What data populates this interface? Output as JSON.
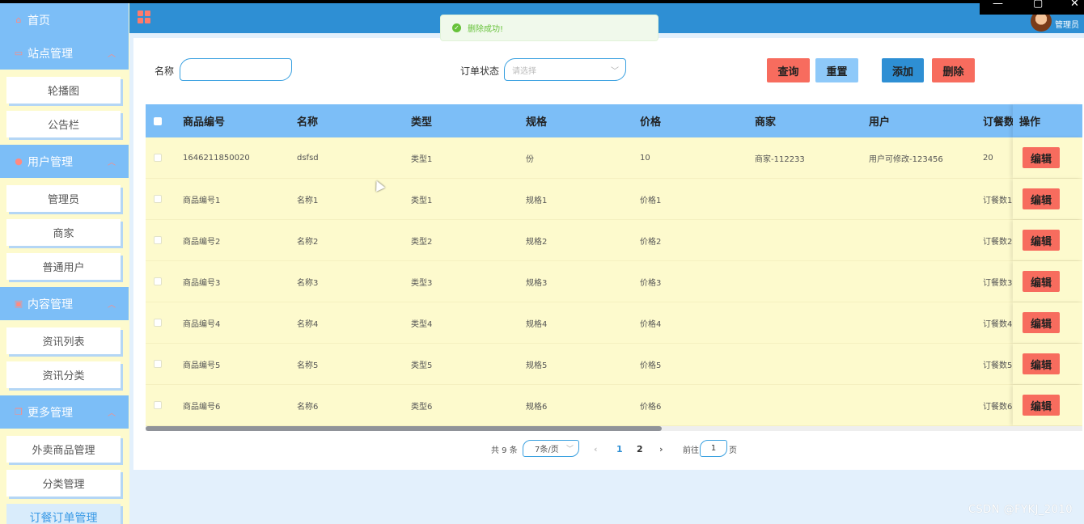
{
  "header": {
    "admin_name": "管理员",
    "window_controls": [
      "—",
      "▢",
      "✕"
    ]
  },
  "toast": {
    "message": "删除成功!"
  },
  "sidebar": {
    "home": "首页",
    "groups": [
      {
        "label": "站点管理",
        "icon": "monitor-icon",
        "items": [
          "轮播图",
          "公告栏"
        ]
      },
      {
        "label": "用户管理",
        "icon": "user-icon",
        "items": [
          "管理员",
          "商家",
          "普通用户"
        ]
      },
      {
        "label": "内容管理",
        "icon": "content-icon",
        "items": [
          "资讯列表",
          "资讯分类"
        ]
      },
      {
        "label": "更多管理",
        "icon": "copy-icon",
        "items": [
          "外卖商品管理",
          "分类管理",
          "订餐订单管理"
        ]
      }
    ],
    "active_item": "订餐订单管理"
  },
  "search": {
    "name_label": "名称",
    "name_value": "",
    "status_label": "订单状态",
    "status_placeholder": "请选择"
  },
  "buttons": {
    "query": "查询",
    "reset": "重置",
    "add": "添加",
    "delete": "删除",
    "edit": "编辑"
  },
  "colors": {
    "query": "#f76c5e",
    "reset": "#8ec9f9",
    "add": "#2e8fd4",
    "delete": "#f76c5e"
  },
  "table": {
    "columns": [
      "商品编号",
      "名称",
      "类型",
      "规格",
      "价格",
      "商家",
      "用户",
      "订餐数",
      "操作"
    ],
    "rows": [
      [
        "1646211850020",
        "dsfsd",
        "类型1",
        "份",
        "10",
        "商家-112233",
        "用户可修改-123456",
        "20"
      ],
      [
        "商品编号1",
        "名称1",
        "类型1",
        "规格1",
        "价格1",
        "",
        "",
        "订餐数1"
      ],
      [
        "商品编号2",
        "名称2",
        "类型2",
        "规格2",
        "价格2",
        "",
        "",
        "订餐数2"
      ],
      [
        "商品编号3",
        "名称3",
        "类型3",
        "规格3",
        "价格3",
        "",
        "",
        "订餐数3"
      ],
      [
        "商品编号4",
        "名称4",
        "类型4",
        "规格4",
        "价格4",
        "",
        "",
        "订餐数4"
      ],
      [
        "商品编号5",
        "名称5",
        "类型5",
        "规格5",
        "价格5",
        "",
        "",
        "订餐数5"
      ],
      [
        "商品编号6",
        "名称6",
        "类型6",
        "规格6",
        "价格6",
        "",
        "",
        "订餐数6"
      ]
    ]
  },
  "pagination": {
    "total": "共 9 条",
    "page_size": "7条/页",
    "prev": "‹",
    "pages": [
      "1",
      "2"
    ],
    "current": "1",
    "next": "›",
    "goto_label": "前往",
    "goto_value": "1",
    "goto_suffix": "页"
  },
  "watermark": "CSDN @FYKJ_2010"
}
